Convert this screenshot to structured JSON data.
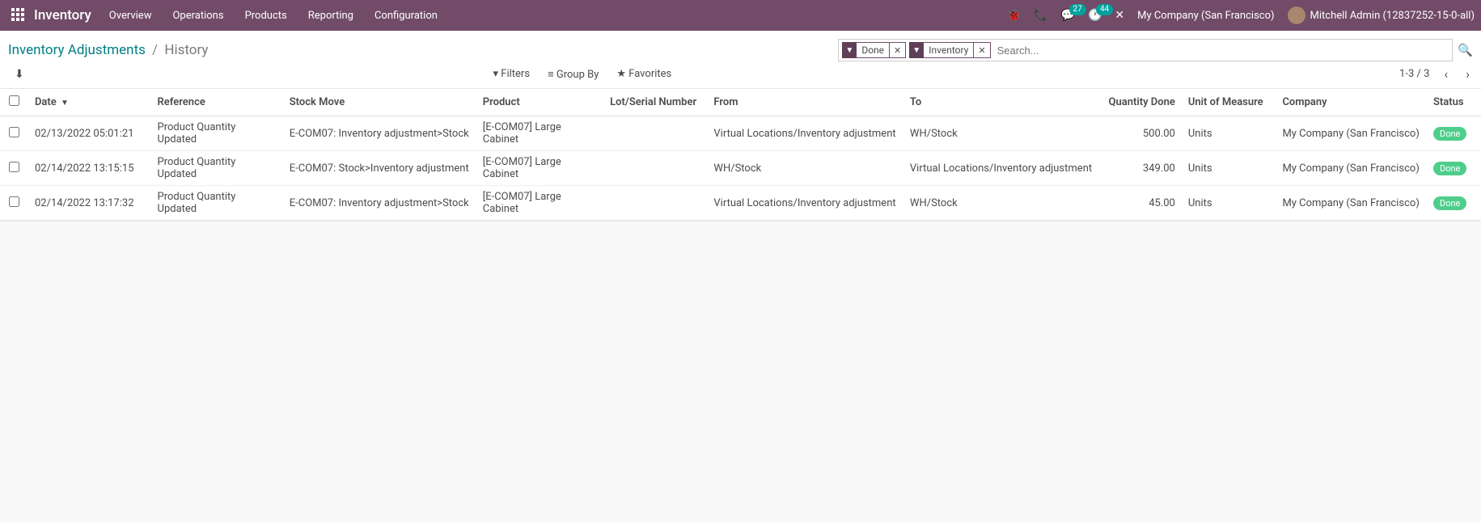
{
  "nav": {
    "brand": "Inventory",
    "menus": [
      "Overview",
      "Operations",
      "Products",
      "Reporting",
      "Configuration"
    ],
    "msg_badge": "27",
    "activity_badge": "44",
    "company": "My Company (San Francisco)",
    "user": "Mitchell Admin (12837252-15-0-all)"
  },
  "breadcrumb": {
    "parent": "Inventory Adjustments",
    "sep": "/",
    "current": "History"
  },
  "search": {
    "facets": [
      {
        "label": "Done"
      },
      {
        "label": "Inventory"
      }
    ],
    "placeholder": "Search..."
  },
  "opts": {
    "filters": "Filters",
    "groupby": "Group By",
    "favorites": "Favorites"
  },
  "pager": {
    "text": "1-3 / 3"
  },
  "columns": {
    "date": "Date",
    "reference": "Reference",
    "move": "Stock Move",
    "product": "Product",
    "lot": "Lot/Serial Number",
    "from": "From",
    "to": "To",
    "qty": "Quantity Done",
    "uom": "Unit of Measure",
    "company": "Company",
    "status": "Status"
  },
  "rows": [
    {
      "date": "02/13/2022 05:01:21",
      "reference": "Product Quantity Updated",
      "move": "E-COM07: Inventory adjustment>Stock",
      "product": "[E-COM07] Large Cabinet",
      "lot": "",
      "from": "Virtual Locations/Inventory adjustment",
      "to": "WH/Stock",
      "qty": "500.00",
      "uom": "Units",
      "company": "My Company (San Francisco)",
      "status": "Done"
    },
    {
      "date": "02/14/2022 13:15:15",
      "reference": "Product Quantity Updated",
      "move": "E-COM07: Stock>Inventory adjustment",
      "product": "[E-COM07] Large Cabinet",
      "lot": "",
      "from": "WH/Stock",
      "to": "Virtual Locations/Inventory adjustment",
      "qty": "349.00",
      "uom": "Units",
      "company": "My Company (San Francisco)",
      "status": "Done"
    },
    {
      "date": "02/14/2022 13:17:32",
      "reference": "Product Quantity Updated",
      "move": "E-COM07: Inventory adjustment>Stock",
      "product": "[E-COM07] Large Cabinet",
      "lot": "",
      "from": "Virtual Locations/Inventory adjustment",
      "to": "WH/Stock",
      "qty": "45.00",
      "uom": "Units",
      "company": "My Company (San Francisco)",
      "status": "Done"
    }
  ]
}
